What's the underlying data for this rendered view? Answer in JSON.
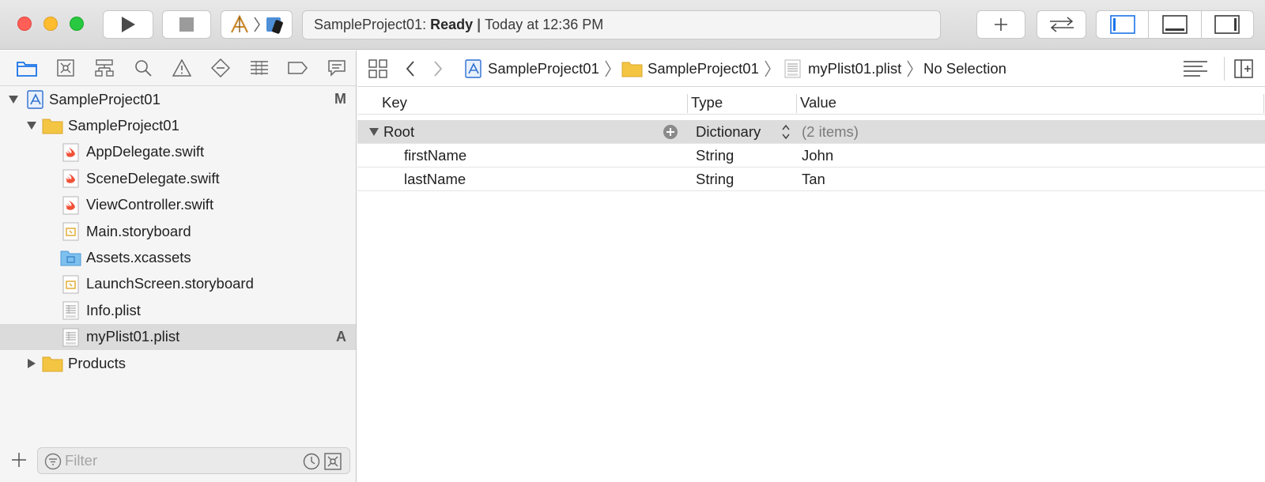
{
  "toolbar": {
    "status_project": "SampleProject01:",
    "status_state": "Ready",
    "status_separator": "|",
    "status_time": "Today at 12:36 PM"
  },
  "navigator": {
    "items": [
      {
        "label": "SampleProject01",
        "badge": "M",
        "icon": "xcode-project-icon",
        "expanded": true
      },
      {
        "label": "SampleProject01",
        "badge": "",
        "icon": "folder-icon",
        "expanded": true
      },
      {
        "label": "AppDelegate.swift",
        "badge": "",
        "icon": "swift-file-icon"
      },
      {
        "label": "SceneDelegate.swift",
        "badge": "",
        "icon": "swift-file-icon"
      },
      {
        "label": "ViewController.swift",
        "badge": "",
        "icon": "swift-file-icon"
      },
      {
        "label": "Main.storyboard",
        "badge": "",
        "icon": "storyboard-icon"
      },
      {
        "label": "Assets.xcassets",
        "badge": "",
        "icon": "asset-catalog-icon"
      },
      {
        "label": "LaunchScreen.storyboard",
        "badge": "",
        "icon": "storyboard-icon"
      },
      {
        "label": "Info.plist",
        "badge": "",
        "icon": "plist-file-icon"
      },
      {
        "label": "myPlist01.plist",
        "badge": "A",
        "icon": "plist-file-icon",
        "selected": true
      },
      {
        "label": "Products",
        "badge": "",
        "icon": "folder-icon",
        "expanded": false
      }
    ],
    "filter_placeholder": "Filter"
  },
  "jumpbar": {
    "crumbs": [
      "SampleProject01",
      "SampleProject01",
      "myPlist01.plist",
      "No Selection"
    ]
  },
  "plist": {
    "headers": {
      "key": "Key",
      "type": "Type",
      "value": "Value"
    },
    "root": {
      "key": "Root",
      "type": "Dictionary",
      "value": "(2 items)"
    },
    "rows": [
      {
        "key": "firstName",
        "type": "String",
        "value": "John"
      },
      {
        "key": "lastName",
        "type": "String",
        "value": "Tan"
      }
    ]
  },
  "colors": {
    "accent": "#1a73e8",
    "selected_row": "#dcdbdc",
    "swift_orange": "#f05138",
    "folder_yellow": "#f4c542"
  }
}
